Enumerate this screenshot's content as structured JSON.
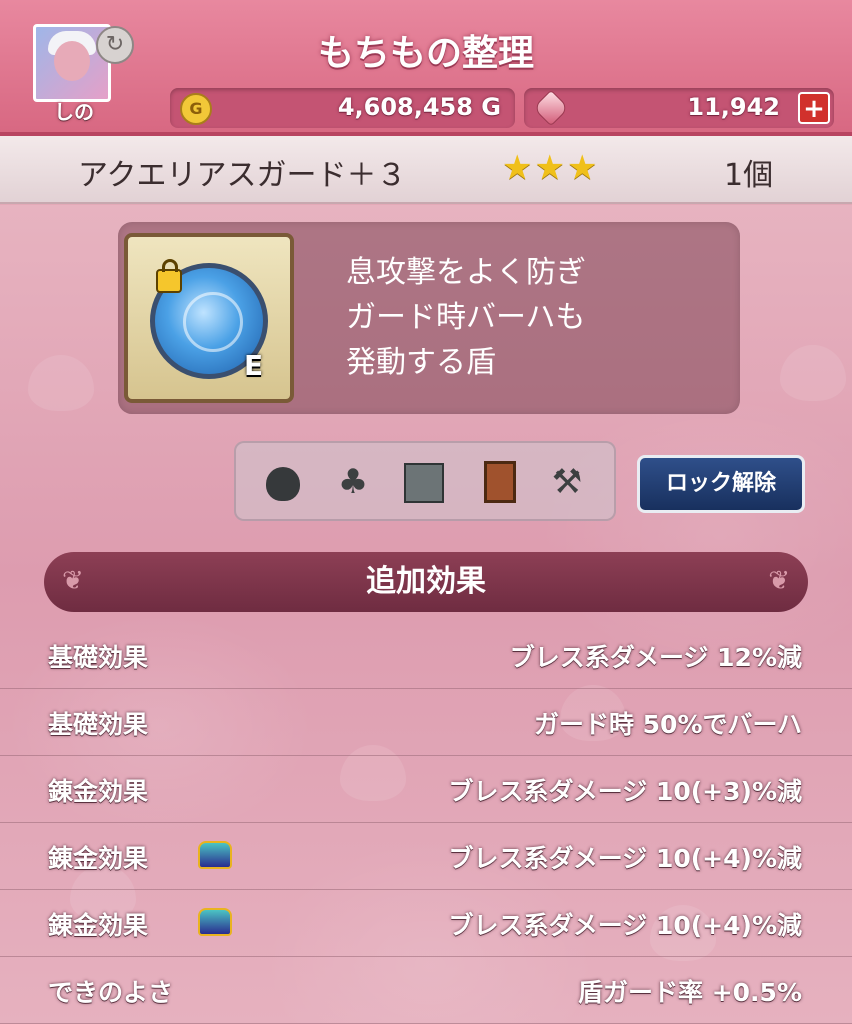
{
  "header": {
    "title": "もちもの整理",
    "player_name": "しの",
    "gold": "4,608,458 G",
    "gems": "11,942",
    "gold_icon_glyph": "G",
    "plus_glyph": "+"
  },
  "item": {
    "name": "アクエリアスガード＋３",
    "stars": "★★★",
    "star_rating": 3,
    "count": "1個",
    "equip_badge": "E",
    "description": "息攻撃をよく防ぎ\nガード時バーハも\n発動する盾"
  },
  "actions": {
    "unlock_label": "ロック解除",
    "icons": [
      "bag-icon",
      "clover-icon",
      "storage-icon",
      "book-icon",
      "anvil-icon"
    ]
  },
  "effects": {
    "header": "追加効果",
    "rows": [
      {
        "label": "基礎効果",
        "value": "ブレス系ダメージ 12%減",
        "crown": false
      },
      {
        "label": "基礎効果",
        "value": "ガード時 50%でバーハ",
        "crown": false
      },
      {
        "label": "錬金効果",
        "value": "ブレス系ダメージ 10(+3)%減",
        "crown": false
      },
      {
        "label": "錬金効果",
        "value": "ブレス系ダメージ 10(+4)%減",
        "crown": true
      },
      {
        "label": "錬金効果",
        "value": "ブレス系ダメージ 10(+4)%減",
        "crown": true
      },
      {
        "label": "できのよさ",
        "value": "盾ガード率 +0.5%",
        "crown": false
      }
    ]
  },
  "colors": {
    "header": "#d86882",
    "accent_blue": "#18305e",
    "star": "#f0c01a"
  }
}
